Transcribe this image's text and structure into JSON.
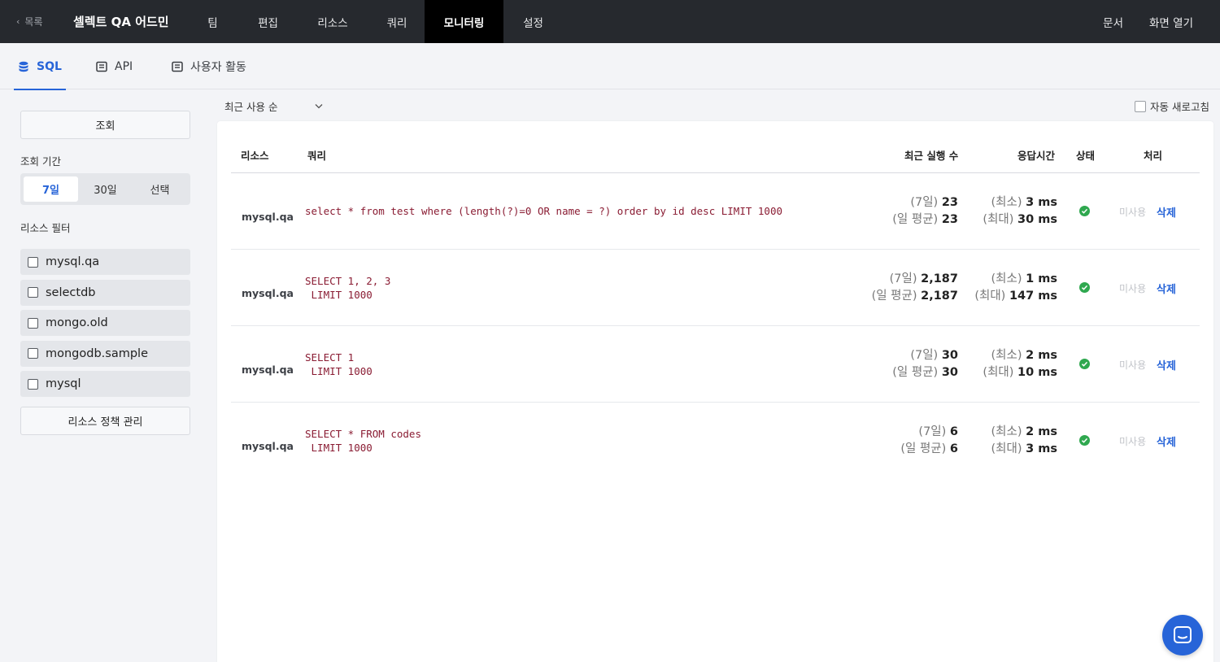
{
  "nav": {
    "back_label": "목록",
    "brand": "셀렉트 QA 어드민",
    "items": [
      {
        "label": "팀"
      },
      {
        "label": "편집"
      },
      {
        "label": "리소스"
      },
      {
        "label": "쿼리"
      },
      {
        "label": "모니터링",
        "active": true
      },
      {
        "label": "설정"
      }
    ],
    "right": [
      {
        "label": "문서"
      },
      {
        "label": "화면 열기"
      }
    ]
  },
  "tabs": [
    {
      "label": "SQL",
      "icon": "database-icon",
      "active": true
    },
    {
      "label": "API",
      "icon": "api-icon"
    },
    {
      "label": "사용자 활동",
      "icon": "activity-icon"
    }
  ],
  "sidebar": {
    "search_button": "조회",
    "period_label": "조회 기간",
    "periods": [
      {
        "label": "7일",
        "active": true
      },
      {
        "label": "30일"
      },
      {
        "label": "선택"
      }
    ],
    "filter_label": "리소스 필터",
    "filters": [
      {
        "label": "mysql.qa",
        "checked": false
      },
      {
        "label": "selectdb",
        "checked": false
      },
      {
        "label": "mongo.old",
        "checked": false
      },
      {
        "label": "mongodb.sample",
        "checked": false
      },
      {
        "label": "mysql",
        "checked": false
      }
    ],
    "policy_button": "리소스 정책 관리"
  },
  "toolbar": {
    "sort_value": "최근 사용 순",
    "auto_refresh_label": "자동 새로고침",
    "auto_refresh_checked": false
  },
  "table": {
    "columns": {
      "resource": "리소스",
      "query": "쿼리",
      "recent_runs": "최근 실행 수",
      "response_time": "응답시간",
      "status": "상태",
      "action": "처리"
    },
    "rows": [
      {
        "resource": "mysql.qa",
        "query_lines": [
          "select * from test where (length(?)=0 OR name = ?) order by id desc LIMIT 1000"
        ],
        "runs_7d_label": "(7일)",
        "runs_7d": "23",
        "runs_avg_label": "(일 평균)",
        "runs_avg": "23",
        "min_label": "(최소)",
        "min": "3 ms",
        "max_label": "(최대)",
        "max": "30 ms",
        "status": "ok",
        "unused_label": "미사용",
        "delete_label": "삭제"
      },
      {
        "resource": "mysql.qa",
        "query_lines": [
          "SELECT 1, 2, 3",
          " LIMIT 1000"
        ],
        "runs_7d_label": "(7일)",
        "runs_7d": "2,187",
        "runs_avg_label": "(일 평균)",
        "runs_avg": "2,187",
        "min_label": "(최소)",
        "min": "1 ms",
        "max_label": "(최대)",
        "max": "147 ms",
        "status": "ok",
        "unused_label": "미사용",
        "delete_label": "삭제"
      },
      {
        "resource": "mysql.qa",
        "query_lines": [
          "SELECT 1",
          " LIMIT 1000"
        ],
        "runs_7d_label": "(7일)",
        "runs_7d": "30",
        "runs_avg_label": "(일 평균)",
        "runs_avg": "30",
        "min_label": "(최소)",
        "min": "2 ms",
        "max_label": "(최대)",
        "max": "10 ms",
        "status": "ok",
        "unused_label": "미사용",
        "delete_label": "삭제"
      },
      {
        "resource": "mysql.qa",
        "query_lines": [
          "SELECT * FROM codes",
          " LIMIT 1000"
        ],
        "runs_7d_label": "(7일)",
        "runs_7d": "6",
        "runs_avg_label": "(일 평균)",
        "runs_avg": "6",
        "min_label": "(최소)",
        "min": "2 ms",
        "max_label": "(최대)",
        "max": "3 ms",
        "status": "ok",
        "unused_label": "미사용",
        "delete_label": "삭제"
      }
    ]
  },
  "colors": {
    "accent": "#2764d8",
    "nav_bg": "#26292e",
    "status_ok": "#2fa84f",
    "query_text": "#8a1c33"
  }
}
